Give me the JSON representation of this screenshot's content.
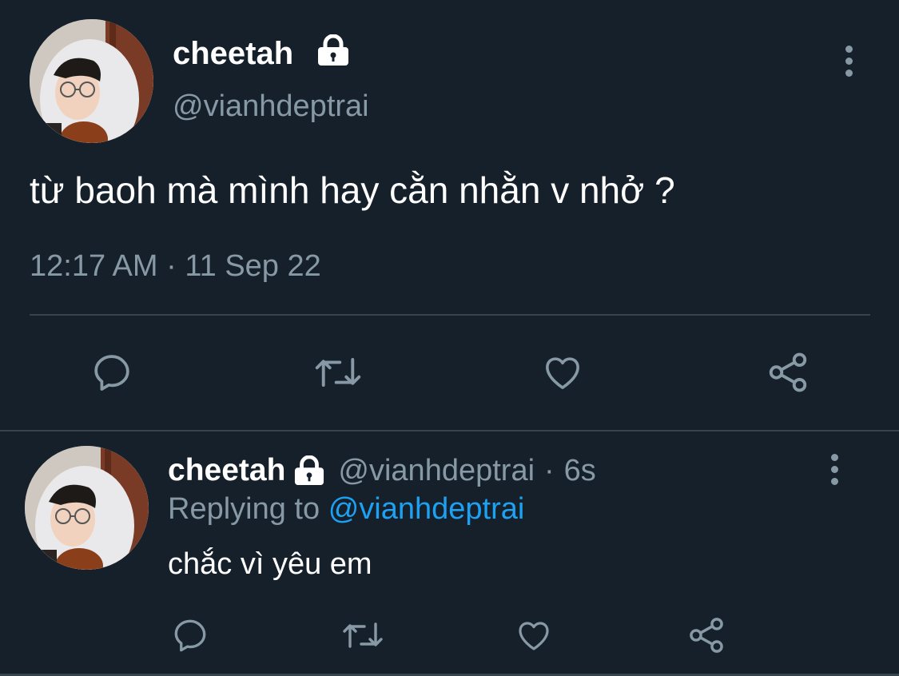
{
  "main_tweet": {
    "display_name": "cheetah",
    "handle": "@vianhdeptrai",
    "text": "từ baoh mà mình hay cằn nhằn v nhở ?",
    "timestamp": "12:17 AM · 11 Sep 22",
    "icons": {
      "lock": "lock-icon",
      "more": "more-options-icon",
      "reply": "reply-icon",
      "retweet": "retweet-icon",
      "like": "like-icon",
      "share": "share-icon"
    }
  },
  "reply_tweet": {
    "display_name": "cheetah",
    "handle": "@vianhdeptrai",
    "separator": "·",
    "time_ago": "6s",
    "replying_to_label": "Replying to",
    "replying_to_handle": "@vianhdeptrai",
    "text": "chắc vì yêu em"
  },
  "colors": {
    "background": "#15202b",
    "text_primary": "#ffffff",
    "text_secondary": "#8899a6",
    "link": "#1da1f2",
    "divider": "#38444d"
  }
}
